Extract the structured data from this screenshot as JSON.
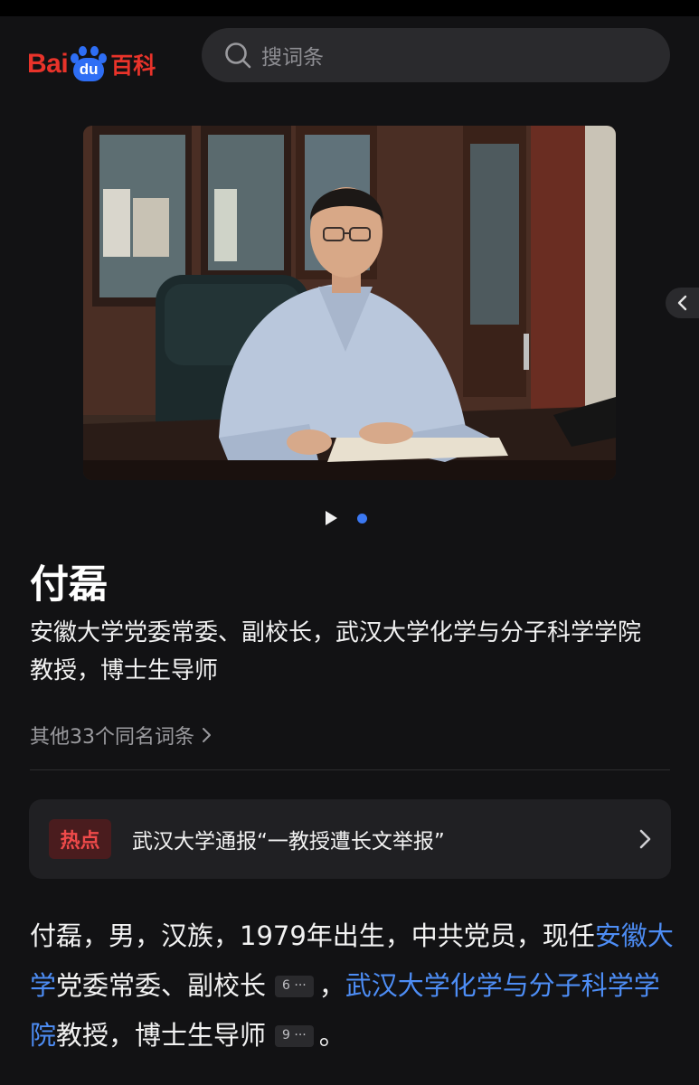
{
  "header": {
    "logo": {
      "part1": "Bai",
      "part2": "du",
      "part3": "百科"
    },
    "search": {
      "placeholder": "搜词条",
      "icon": "search-icon"
    }
  },
  "carousel": {
    "slides": 2,
    "active_slide": 2,
    "indicator_icon": "play-icon",
    "side_button_icon": "chevron-left-icon"
  },
  "entry": {
    "name": "付磊",
    "subtitle": "安徽大学党委常委、副校长，武汉大学化学与分子科学学院教授，博士生导师",
    "others_link": "其他33个同名词条"
  },
  "hot": {
    "badge": "热点",
    "text": "武汉大学通报“一教授遭长文举报”",
    "icon": "chevron-right-icon"
  },
  "summary": {
    "part1": "付磊，男，汉族，1979年出生，中共党员，现任",
    "link1": "安徽大学",
    "part2": "党委常委、副校长",
    "ref1": "6 ···",
    "part3": "，",
    "link2": "武汉大学化学与分子科学学院",
    "part4": "教授，博士生导师",
    "ref2": "9 ···",
    "part5": "。"
  },
  "colors": {
    "background": "#121214",
    "brand_red": "#e8332a",
    "brand_blue": "#2e6ef5",
    "link": "#4d8df5",
    "hot_badge_text": "#ef4a4a"
  }
}
